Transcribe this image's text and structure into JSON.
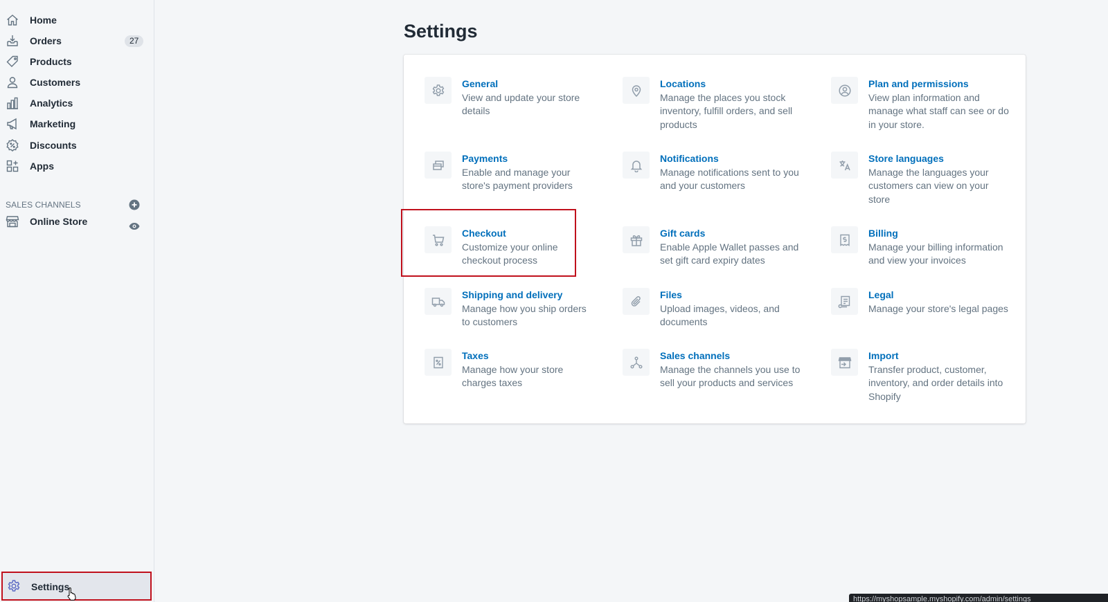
{
  "sidebar": {
    "nav": [
      {
        "label": "Home",
        "icon": "home-icon"
      },
      {
        "label": "Orders",
        "icon": "orders-icon",
        "badge": "27"
      },
      {
        "label": "Products",
        "icon": "products-tag-icon"
      },
      {
        "label": "Customers",
        "icon": "customers-person-icon"
      },
      {
        "label": "Analytics",
        "icon": "analytics-bar-icon"
      },
      {
        "label": "Marketing",
        "icon": "marketing-megaphone-icon"
      },
      {
        "label": "Discounts",
        "icon": "discounts-icon"
      },
      {
        "label": "Apps",
        "icon": "apps-grid-icon"
      }
    ],
    "sales_channels_title": "SALES CHANNELS",
    "online_store_label": "Online Store",
    "settings_label": "Settings"
  },
  "main": {
    "title": "Settings",
    "tiles": [
      {
        "title": "General",
        "description": "View and update your store details",
        "icon": "gear-icon"
      },
      {
        "title": "Locations",
        "description": "Manage the places you stock inventory, fulfill orders, and sell products",
        "icon": "location-pin-icon"
      },
      {
        "title": "Plan and permissions",
        "description": "View plan information and manage what staff can see or do in your store.",
        "icon": "user-circle-icon"
      },
      {
        "title": "Payments",
        "description": "Enable and manage your store's payment providers",
        "icon": "payments-icon"
      },
      {
        "title": "Notifications",
        "description": "Manage notifications sent to you and your customers",
        "icon": "bell-icon"
      },
      {
        "title": "Store languages",
        "description": "Manage the languages your customers can view on your store",
        "icon": "translate-icon"
      },
      {
        "title": "Checkout",
        "description": "Customize your online checkout process",
        "icon": "cart-icon"
      },
      {
        "title": "Gift cards",
        "description": "Enable Apple Wallet passes and set gift card expiry dates",
        "icon": "gift-icon"
      },
      {
        "title": "Billing",
        "description": "Manage your billing information and view your invoices",
        "icon": "billing-receipt-icon"
      },
      {
        "title": "Shipping and delivery",
        "description": "Manage how you ship orders to customers",
        "icon": "truck-icon"
      },
      {
        "title": "Files",
        "description": "Upload images, videos, and documents",
        "icon": "paperclip-icon"
      },
      {
        "title": "Legal",
        "description": "Manage your store's legal pages",
        "icon": "legal-document-icon"
      },
      {
        "title": "Taxes",
        "description": "Manage how your store charges taxes",
        "icon": "tax-icon"
      },
      {
        "title": "Sales channels",
        "description": "Manage the channels you use to sell your products and services",
        "icon": "channels-icon"
      },
      {
        "title": "Import",
        "description": "Transfer product, customer, inventory, and order details into Shopify",
        "icon": "import-icon"
      }
    ]
  },
  "status_bar": {
    "url": "https://myshopsample.myshopify.com/admin/settings"
  },
  "colors": {
    "link": "#006fbb",
    "highlight": "#c0101c",
    "sidebar_bg": "#f4f6f8",
    "active_icon": "#5c6ac4"
  }
}
